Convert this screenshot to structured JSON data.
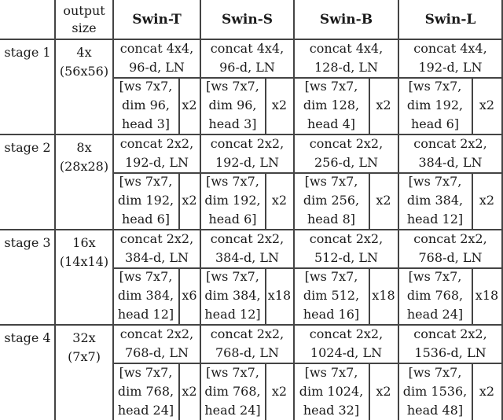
{
  "table": {
    "header": {
      "output_size": "output\nsize",
      "models": [
        "Swin-T",
        "Swin-S",
        "Swin-B",
        "Swin-L"
      ]
    },
    "stages": [
      {
        "label": "stage 1",
        "output_size": "4x\n(56x56)",
        "merge": [
          "concat 4x4,\n96-d, LN",
          "concat 4x4,\n96-d, LN",
          "concat 4x4,\n128-d, LN",
          "concat 4x4,\n192-d, LN"
        ],
        "block": [
          "[ws 7x7,\ndim 96,\nhead 3]",
          "[ws 7x7,\ndim 96,\nhead 3]",
          "[ws 7x7,\ndim 128,\nhead 4]",
          "[ws 7x7,\ndim 192,\nhead 6]"
        ],
        "repeat": [
          "x2",
          "x2",
          "x2",
          "x2"
        ]
      },
      {
        "label": "stage 2",
        "output_size": "8x\n(28x28)",
        "merge": [
          "concat 2x2,\n192-d, LN",
          "concat 2x2,\n192-d, LN",
          "concat 2x2,\n256-d, LN",
          "concat 2x2,\n384-d, LN"
        ],
        "block": [
          "[ws 7x7,\ndim 192,\nhead 6]",
          "[ws 7x7,\ndim 192,\nhead 6]",
          "[ws 7x7,\ndim 256,\nhead 8]",
          "[ws 7x7,\ndim 384,\nhead 12]"
        ],
        "repeat": [
          "x2",
          "x2",
          "x2",
          "x2"
        ]
      },
      {
        "label": "stage 3",
        "output_size": "16x\n(14x14)",
        "merge": [
          "concat 2x2,\n384-d, LN",
          "concat 2x2,\n384-d, LN",
          "concat 2x2,\n512-d, LN",
          "concat 2x2,\n768-d, LN"
        ],
        "block": [
          "[ws 7x7,\ndim 384,\nhead 12]",
          "[ws 7x7,\ndim 384,\nhead 12]",
          "[ws 7x7,\ndim 512,\nhead 16]",
          "[ws 7x7,\ndim 768,\nhead 24]"
        ],
        "repeat": [
          "x6",
          "x18",
          "x18",
          "x18"
        ]
      },
      {
        "label": "stage 4",
        "output_size": "32x\n(7x7)",
        "merge": [
          "concat 2x2,\n768-d, LN",
          "concat 2x2,\n768-d, LN",
          "concat 2x2,\n1024-d, LN",
          "concat 2x2,\n1536-d, LN"
        ],
        "block": [
          "[ws 7x7,\ndim 768,\nhead 24]",
          "[ws 7x7,\ndim 768,\nhead 24]",
          "[ws 7x7,\ndim 1024,\nhead 32]",
          "[ws 7x7,\ndim 1536,\nhead 48]"
        ],
        "repeat": [
          "x2",
          "x2",
          "x2",
          "x2"
        ]
      }
    ]
  }
}
